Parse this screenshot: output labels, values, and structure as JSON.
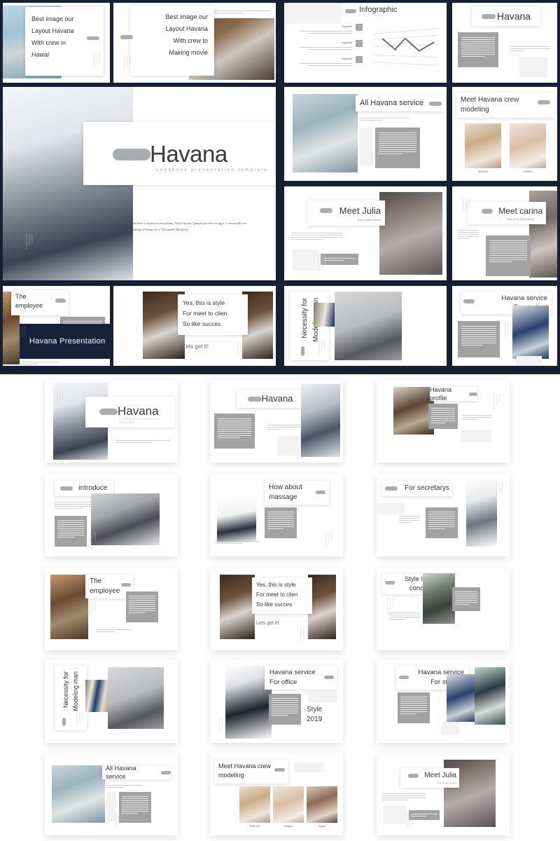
{
  "meta": {
    "accent_pill": "#aaadb0",
    "dark_bg": "#171f33",
    "gray_block": "#a2a2a2",
    "banner_bg": "#16213a"
  },
  "lorem": {
    "gray_block": "Style is the only thing you can't buy. It's not in a shopping bag, a label, or a price tag. It's something reflected from our soul to the outside. pulvinar ultricies purus lectus malesuada ut Lorem ipsum dolor sit amet consectetuer adipiscing elit Maecenas congue massa Fusce posuere magna sed pulvinar ultricies purus",
    "small_note": "Sometimes I'll start a sentence and I don't even know where it's going. I just hope I find it along the way.",
    "quote": "I think there is beauty in everything. What 'normal' people perceive as ugly, I can usually see something of beauty in it.\"Alexander McQueen",
    "identity": "identity theft is not a joke, jim! millions of families suffer every year",
    "intro_note": "Loved by fans and critically acclaimed for most of its run The Office is a remarkable sitcom that repeatedly broke the fourth wall and introduced the world to a group of memorable characters.",
    "vertical_label": "Havana Lookbook Presentation"
  },
  "slides_dark": [
    {
      "id": "best-image-hawai",
      "lines": [
        "Best image our",
        "Layout Havana",
        "With crew in",
        "Hawai"
      ],
      "align": "left",
      "photo": "beach-photographer"
    },
    {
      "id": "best-image-movie",
      "lines": [
        "Best image our",
        "Layout Havana",
        "With crew to",
        "Making movie"
      ],
      "align": "right",
      "photo": "studio-crew"
    },
    {
      "id": "infographic",
      "title": "Infographic",
      "items": [
        {
          "label": "important",
          "body": "lorem ipsum dolor sit amet consectetuer adipiscing elit maecenas porttitor congue massa Fusce posuere"
        },
        {
          "label": "important",
          "body": "lorem ipsum dolor sit amet consectetuer adipiscing elit maecenas porttitor congue massa Fusce posuere"
        },
        {
          "label": "important",
          "body": "lorem ipsum dolor sit amet consectetuer adipiscing elit maecenas porttitor congue massa Fusce posuere"
        }
      ]
    },
    {
      "id": "havana-plain",
      "title": "Havana"
    },
    {
      "id": "hero-havana",
      "title": "Havana",
      "subtitle": "Lookbook presentation template",
      "photo": "business-man-suit"
    },
    {
      "id": "all-havana-service",
      "title": "All Havana service",
      "photo": "office-meeting"
    },
    {
      "id": "meet-havana-crew",
      "title": "Meet Havana crew modeling",
      "members": [
        {
          "name": "Melinda",
          "photo": "blonde-model"
        },
        {
          "name": "Johana",
          "photo": "johana-model"
        }
      ]
    },
    {
      "id": "meet-julia",
      "title": "Meet Julia",
      "subtitle": "Team creator havana",
      "photo": "julia-model"
    },
    {
      "id": "meet-carina",
      "title": "Meet carina",
      "subtitle": "Team photo shoot havana",
      "photo": "carina-model"
    },
    {
      "id": "the-employee",
      "title": "The employee",
      "banner": "Havana Presentation",
      "photo": "employee-photo"
    },
    {
      "id": "yes-this-is-style",
      "lines": [
        "Yes, this is style",
        "For meet to clien",
        "So like succes"
      ],
      "cta": "Lets get it!",
      "photos": [
        "man-tie-left",
        "man-suit-right"
      ]
    },
    {
      "id": "necessity-modeling-man",
      "title": "Necessity for Modeling man",
      "photos": [
        "tie-rack",
        "group-men"
      ]
    },
    {
      "id": "havana-service-student",
      "title": "Havana service For student",
      "photo": "student-boy"
    }
  ],
  "slides_light": [
    {
      "id": "havana-title-light",
      "title": "Havana",
      "subtitle": "Lookbook presentation template",
      "photo": "business-man-suit"
    },
    {
      "id": "havana-simple",
      "title": "Havana"
    },
    {
      "id": "havana-profile",
      "title": "Havana profile",
      "photo": "profile-glasses-man"
    },
    {
      "id": "introduce",
      "title": "introduce",
      "photo": "handshake-meeting"
    },
    {
      "id": "how-about-massage",
      "title": "How about massage",
      "photo": "massage-presenter"
    },
    {
      "id": "for-secretarys",
      "title": "For secretarys",
      "photo": "secretary-woman"
    },
    {
      "id": "the-employee-light",
      "title": "The employee",
      "photo": "employee-photo"
    },
    {
      "id": "yes-this-is-style-light",
      "lines": [
        "Yes, this is style",
        "For meet to clien",
        "So like succes"
      ],
      "cta": "Lets get it!"
    },
    {
      "id": "style-live-concert",
      "title": "Style live concert",
      "photo": "guitar-man"
    },
    {
      "id": "necessity-modeling-man-light",
      "title": "Necessity for Modeling man"
    },
    {
      "id": "havana-service-office",
      "title": "Havana service For office",
      "style_label": "Style",
      "style_year": "2019",
      "photo": "office-lady"
    },
    {
      "id": "havana-service-student-light",
      "title": "Havana service For student"
    },
    {
      "id": "all-havana-service-light",
      "title": "All Havana service"
    },
    {
      "id": "meet-havana-crew-light",
      "title": "Meet Havana crew modeling",
      "members": [
        {
          "name": "Melinda"
        },
        {
          "name": "Johana"
        },
        {
          "name": "Alicia"
        }
      ]
    },
    {
      "id": "meet-julia-light",
      "title": "Meet Julia",
      "subtitle": "Team creator havana"
    }
  ],
  "titles": {
    "havana": "Havana",
    "havana_sub": "Lookbook presentation template",
    "infographic": "Infographic",
    "all_service": "All Havana service",
    "crew_line1": "Meet Havana crew",
    "crew_line2": "modeling",
    "meet_julia": "Meet Julia",
    "julia_sub": "Team creator havana",
    "meet_carina": "Meet carina",
    "carina_sub": "Team photo shoot havana",
    "the": "The",
    "employee": "employee",
    "banner": "Havana Presentation",
    "style1": "Yes, this is style",
    "style2": "For meet to clien",
    "style3": "So like succes",
    "lets_get_it": "Lets get it!",
    "necessity1": "Necessity for",
    "necessity2": "Modeling man",
    "service_student1": "Havana service",
    "service_student2": "For student",
    "service_office1": "Havana service",
    "service_office2": "For office",
    "style_word": "Style",
    "style_year": "2019",
    "profile": "Havana profile",
    "introduce": "introduce",
    "massage1": "How about",
    "massage2": "massage",
    "secretarys": "For secretarys",
    "concert1": "Style live",
    "concert2": "concert",
    "best1": "Best image our",
    "best2": "Layout Havana",
    "best3a": "With crew in",
    "best4a": "Hawai",
    "best3b": "With crew to",
    "best4b": "Making movie",
    "important": "important",
    "melinda": "Melinda",
    "johana": "Johana",
    "alicia": "Alicia"
  }
}
